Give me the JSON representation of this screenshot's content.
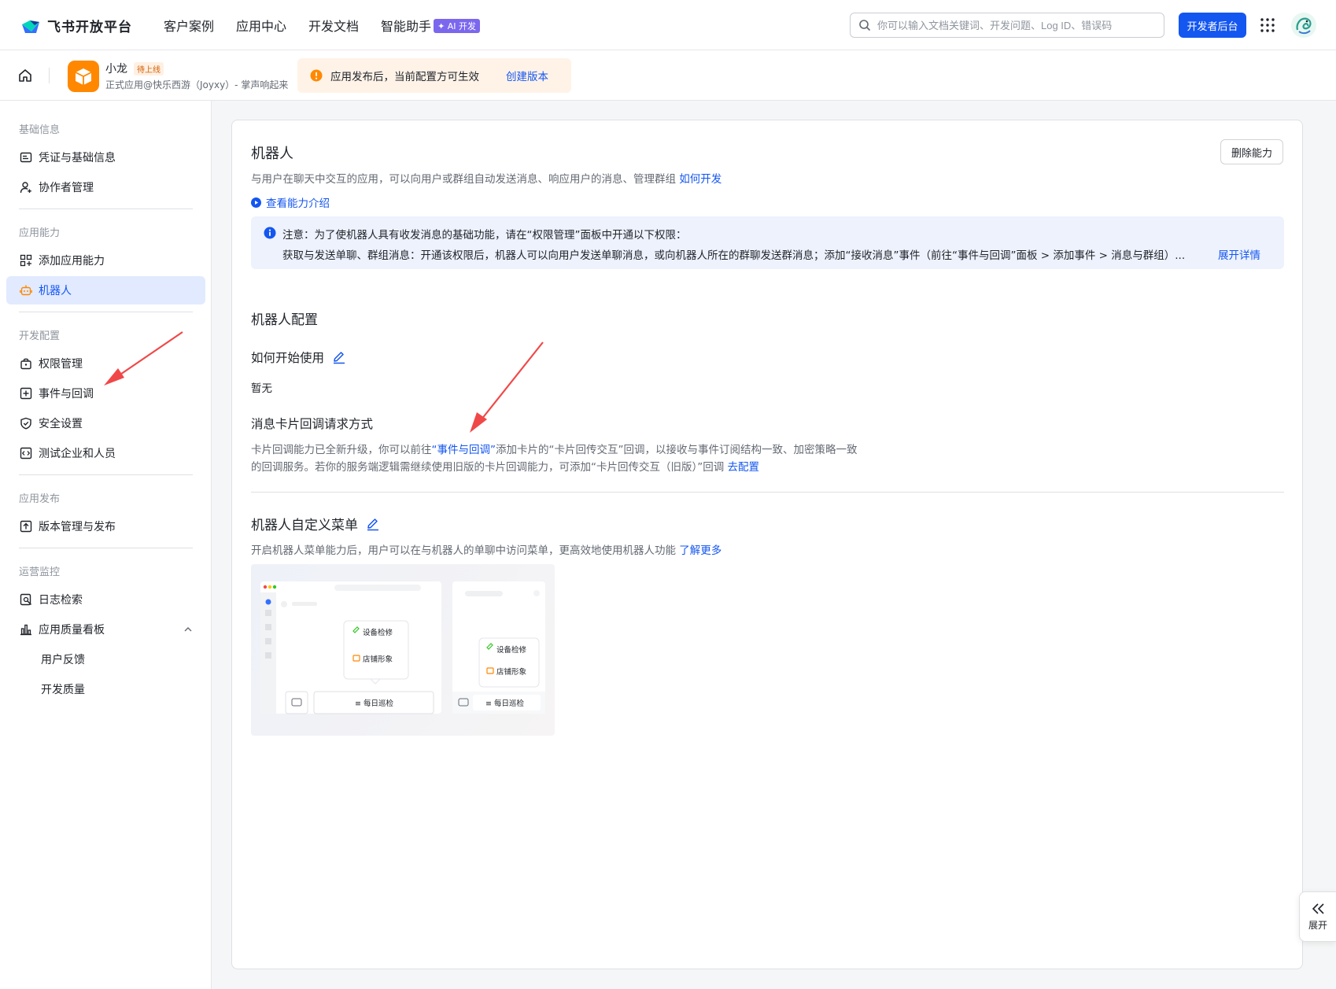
{
  "brand": {
    "name": "飞书开放平台"
  },
  "nav": {
    "items": [
      "客户案例",
      "应用中心",
      "开发文档",
      "智能助手"
    ],
    "ai_badge": "AI 开发"
  },
  "search": {
    "placeholder": "你可以输入文档关键词、开发问题、Log ID、错误码"
  },
  "header": {
    "dev_console_label": "开发者后台"
  },
  "app": {
    "name": "小龙",
    "status": "待上线",
    "desc": "正式应用@快乐西游（Joyxy）- 掌声响起来",
    "notice": "应用发布后，当前配置方可生效",
    "notice_link": "创建版本"
  },
  "sidebar": {
    "groups": [
      "基础信息",
      "应用能力",
      "开发配置",
      "应用发布",
      "运营监控"
    ],
    "items": [
      {
        "label": "凭证与基础信息",
        "icon": "credential-icon"
      },
      {
        "label": "协作者管理",
        "icon": "user-add-icon"
      },
      {
        "label": "添加应用能力",
        "icon": "apps-add-icon"
      },
      {
        "label": "机器人",
        "icon": "robot-icon"
      },
      {
        "label": "权限管理",
        "icon": "lock-icon"
      },
      {
        "label": "事件与回调",
        "icon": "event-icon"
      },
      {
        "label": "安全设置",
        "icon": "shield-icon"
      },
      {
        "label": "测试企业和人员",
        "icon": "code-icon"
      },
      {
        "label": "版本管理与发布",
        "icon": "upload-icon"
      },
      {
        "label": "日志检索",
        "icon": "log-search-icon"
      },
      {
        "label": "应用质量看板",
        "icon": "bar-chart-icon"
      },
      {
        "label": "用户反馈",
        "icon": ""
      },
      {
        "label": "开发质量",
        "icon": ""
      }
    ],
    "active_item": "机器人"
  },
  "bot": {
    "title": "机器人",
    "desc": "与用户在聊天中交互的应用，可以向用户或群组自动发送消息、响应用户的消息、管理群组",
    "desc_link": "如何开发",
    "delete_label": "删除能力",
    "intro_link": "查看能力介绍",
    "tip_line1": "注意：为了使机器人具有收发消息的基础功能，请在“权限管理”面板中开通以下权限：",
    "tip_line2": "获取与发送单聊、群组消息：开通该权限后，机器人可以向用户发送单聊消息，或向机器人所在的群聊发送群消息；添加“接收消息”事件（前往“事件与回调”面板 > 添加事件 > 消息与群组）...",
    "tip_more": "展开详情"
  },
  "config": {
    "title": "机器人配置",
    "howto_title": "如何开始使用",
    "howto_value": "暂无",
    "card_title": "消息卡片回调请求方式",
    "card_desc1_a": "卡片回调能力已全新升级，你可以前往",
    "card_desc1_link": "“事件与回调”",
    "card_desc1_b": "添加卡片的“卡片回传交互”回调，以接收与事件订阅结构一致、加密策略一致",
    "card_desc2": "的回调服务。若你的服务端逻辑需继续使用旧版的卡片回调能力，可添加“卡片回传交互（旧版）”回调",
    "card_desc2_link": "去配置"
  },
  "menu": {
    "title": "机器人自定义菜单",
    "desc": "开启机器人菜单能力后，用户可以在与机器人的单聊中访问菜单，更高效地使用机器人功能",
    "desc_link": "了解更多",
    "preview": {
      "items": [
        "设备检修",
        "店铺形象"
      ],
      "bottom": "每日巡检"
    }
  },
  "expand": {
    "label": "展开"
  },
  "colors": {
    "primary": "#1456f0",
    "warning": "#ff8800",
    "annotation_arrow": "#f04848"
  }
}
